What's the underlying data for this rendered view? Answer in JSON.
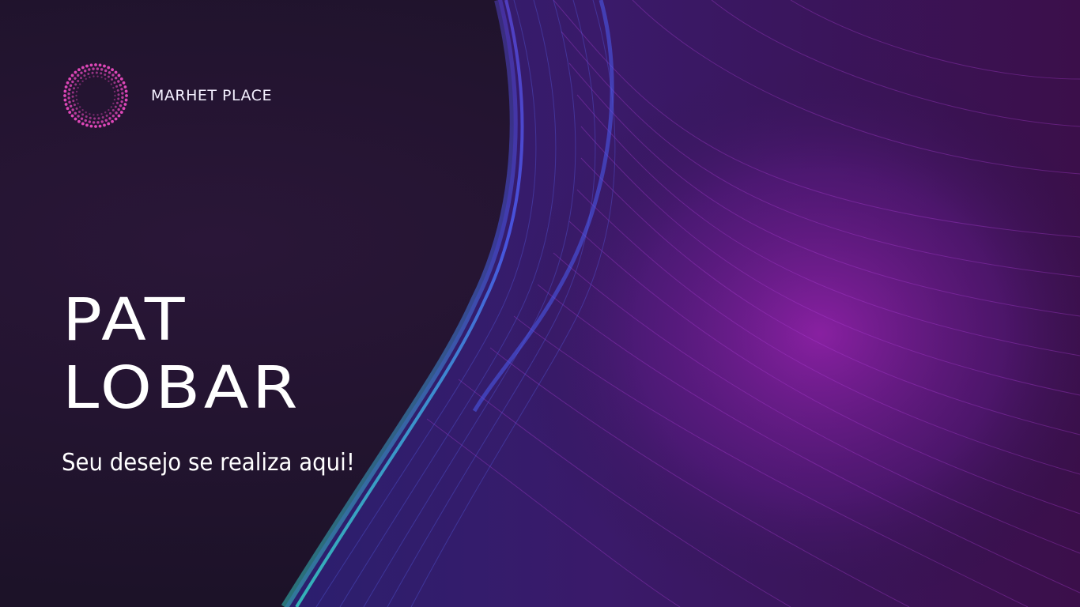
{
  "brand": {
    "name": "MARHET PLACE",
    "logo_icon": "dotted-ring-icon"
  },
  "hero": {
    "title_line1": "PAT",
    "title_line2": "LOBAR",
    "tagline": "Seu desejo se realiza aqui!"
  },
  "colors": {
    "background": "#20142f",
    "wave_cyan": "#36d6c8",
    "wave_blue": "#4a5cf0",
    "wave_magenta": "#a224b8",
    "logo_pink": "#e94ac0"
  }
}
